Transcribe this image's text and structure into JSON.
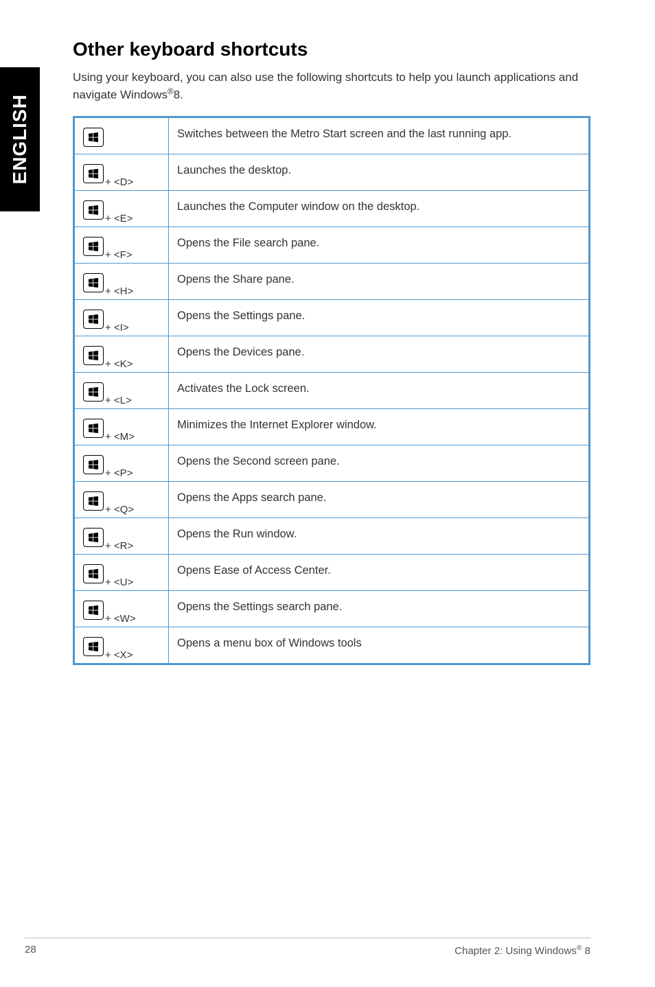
{
  "sideTab": "ENGLISH",
  "heading": "Other keyboard shortcuts",
  "intro_prefix": "Using your keyboard, you can also use the following shortcuts to help you launch applications and navigate Windows",
  "intro_suffix": "8.",
  "registered": "®",
  "shortcuts": [
    {
      "combo": "",
      "desc": "Switches between the Metro Start screen and the last running app."
    },
    {
      "combo": " + <D>",
      "desc": "Launches the desktop."
    },
    {
      "combo": " + <E>",
      "desc": "Launches the Computer window on the desktop."
    },
    {
      "combo": " + <F>",
      "desc": "Opens the File search pane."
    },
    {
      "combo": " + <H>",
      "desc": "Opens the Share pane."
    },
    {
      "combo": " + <I>",
      "desc": "Opens the Settings pane."
    },
    {
      "combo": " + <K>",
      "desc": "Opens the Devices pane."
    },
    {
      "combo": " + <L>",
      "desc": "Activates the Lock screen."
    },
    {
      "combo": " + <M>",
      "desc": "Minimizes the Internet Explorer window."
    },
    {
      "combo": " + <P>",
      "desc": "Opens the Second screen pane."
    },
    {
      "combo": " + <Q>",
      "desc": "Opens the Apps search pane."
    },
    {
      "combo": " + <R>",
      "desc": "Opens the Run window."
    },
    {
      "combo": " + <U>",
      "desc": "Opens Ease of Access Center."
    },
    {
      "combo": " + <W>",
      "desc": "Opens the Settings search pane."
    },
    {
      "combo": " + <X>",
      "desc": "Opens a menu box of Windows tools"
    }
  ],
  "footer": {
    "pageNumber": "28",
    "chapter_prefix": "Chapter 2: Using Windows",
    "chapter_suffix": " 8"
  }
}
